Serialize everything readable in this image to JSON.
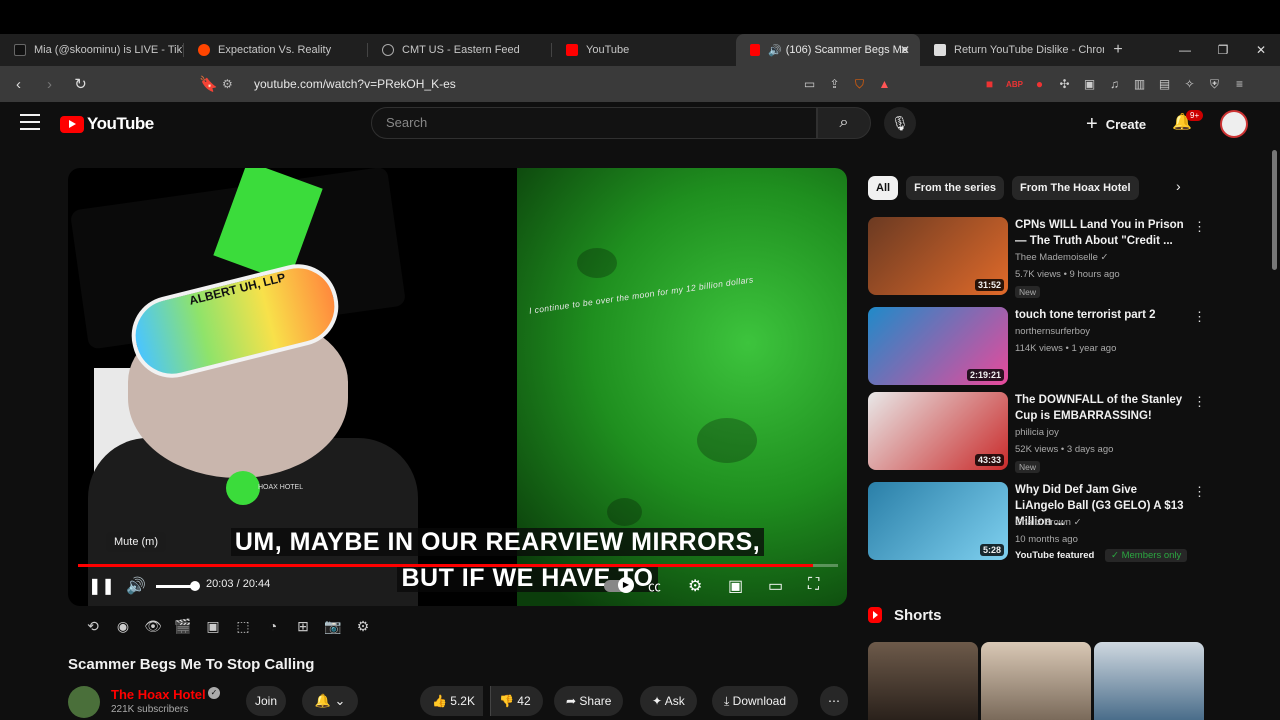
{
  "browser": {
    "tabs": [
      {
        "label": "Mia (@skoominu) is LIVE - TikTo",
        "fav_color": "#111111"
      },
      {
        "label": "Expectation Vs. Reality",
        "fav_color": "#ff4500"
      },
      {
        "label": "CMT US - Eastern Feed",
        "fav_color": "#888888"
      },
      {
        "label": "YouTube",
        "fav_color": "#ff0000"
      },
      {
        "label": "(106) Scammer Begs Me",
        "fav_color": "#ff0000"
      },
      {
        "label": "Return YouTube Dislike - Chrom",
        "fav_color": "#cccccc"
      }
    ],
    "url": "youtube.com/watch?v=PRekOH_K-es"
  },
  "masthead": {
    "logo_text": "YouTube",
    "search_placeholder": "Search",
    "create_label": "Create",
    "notif_badge": "9+"
  },
  "player": {
    "overlay_text": "ALBERT UH, LLP",
    "shirt_text": "HOAX HOTEL",
    "moon_text": "I continue to be over the moon for my 12 billion dollars",
    "caption_line1": "UM, MAYBE IN OUR REARVIEW MIRRORS,",
    "caption_line2": "BUT IF WE HAVE TO",
    "tooltip": "Mute (m)",
    "time": "20:03 / 20:44",
    "progress": 0.967,
    "volume": 0.85
  },
  "video": {
    "title": "Scammer Begs Me To Stop Calling",
    "channel": "The Hoax Hotel",
    "subs": "221K subscribers",
    "join": "Join",
    "likes": "5.2K",
    "dislikes": "42",
    "share": "Share",
    "ask": "Ask",
    "download": "Download"
  },
  "sidebar": {
    "chips": [
      "All",
      "From the series",
      "From The Hoax Hotel"
    ],
    "videos": [
      {
        "title": "CPNs WILL Land You in Prison — The Truth About \"Credit ...",
        "channel": "Thee Mademoiselle",
        "verified": true,
        "meta": "5.7K views • 9 hours ago",
        "new": "New",
        "duration": "31:52",
        "thumb_color": "#6b3a22"
      },
      {
        "title": "touch tone terrorist part 2",
        "channel": "northernsurferboy",
        "verified": false,
        "meta": "114K views • 1 year ago",
        "new": "",
        "duration": "2:19:21",
        "thumb_color": "#1f8ac9"
      },
      {
        "title": "The DOWNFALL of the Stanley Cup is EMBARRASSING!",
        "channel": "philicia joy",
        "verified": false,
        "meta": "52K views • 3 days ago",
        "new": "New",
        "duration": "43:33",
        "thumb_color": "#c92a2a"
      },
      {
        "title": "Why Did Def Jam Give LiAngelo Ball (G3 GELO) A $13 Million ...",
        "channel": "Challz Brown",
        "verified": true,
        "meta": "10 months ago",
        "new": "",
        "duration": "5:28",
        "thumb_color": "#2a7fa8",
        "featured": "YouTube featured",
        "members": "Members only"
      }
    ],
    "shorts_label": "Shorts"
  }
}
